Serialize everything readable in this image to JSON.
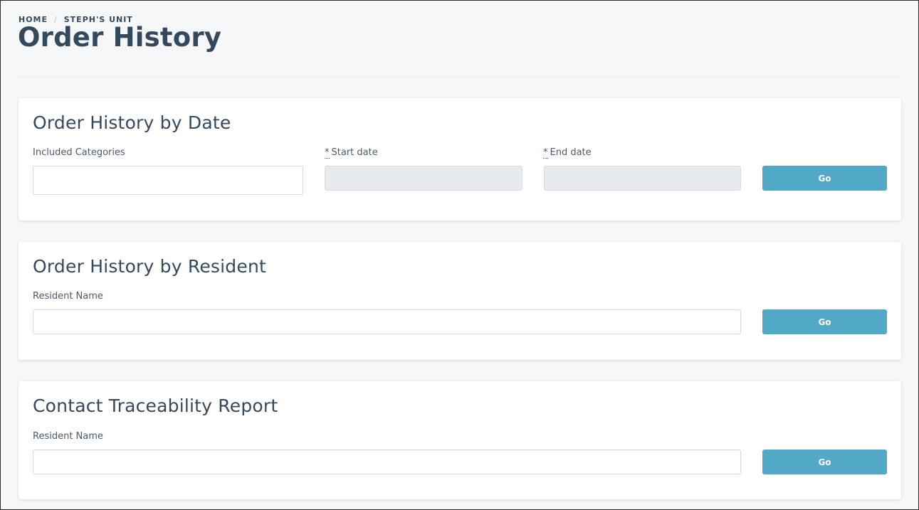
{
  "breadcrumb": {
    "home": "HOME",
    "separator": "/",
    "unit": "STEPH'S UNIT"
  },
  "page_title": "Order History",
  "cards": {
    "by_date": {
      "title": "Order History by Date",
      "categories_label": "Included Categories",
      "categories_value": "",
      "required_mark": "*",
      "start_label": "Start date",
      "start_value": "",
      "end_label": "End date",
      "end_value": "",
      "go_label": "Go"
    },
    "by_resident": {
      "title": "Order History by Resident",
      "resident_label": "Resident Name",
      "resident_value": "",
      "go_label": "Go"
    },
    "traceability": {
      "title": "Contact Traceability Report",
      "resident_label": "Resident Name",
      "resident_value": "",
      "go_label": "Go"
    }
  },
  "colors": {
    "background": "#f6f7f9",
    "text": "#34495e",
    "button": "#52a8c7",
    "disabled_input": "#e7eaee"
  }
}
